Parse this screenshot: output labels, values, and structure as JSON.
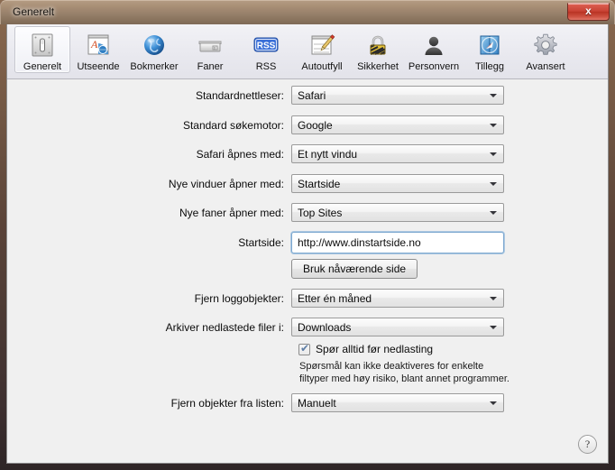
{
  "window": {
    "title": "Generelt",
    "close_label": "x",
    "frame_color": "#6e5442",
    "accent_close": "#c94335"
  },
  "toolbar": {
    "items": [
      {
        "label": "Generelt",
        "icon": "switch-icon",
        "selected": true
      },
      {
        "label": "Utseende",
        "icon": "appearance-icon",
        "selected": false
      },
      {
        "label": "Bokmerker",
        "icon": "globe-icon",
        "selected": false
      },
      {
        "label": "Faner",
        "icon": "tabs-icon",
        "selected": false
      },
      {
        "label": "RSS",
        "icon": "rss-icon",
        "selected": false
      },
      {
        "label": "Autoutfyll",
        "icon": "autofill-icon",
        "selected": false
      },
      {
        "label": "Sikkerhet",
        "icon": "lock-icon",
        "selected": false
      },
      {
        "label": "Personvern",
        "icon": "person-icon",
        "selected": false
      },
      {
        "label": "Tillegg",
        "icon": "extensions-icon",
        "selected": false
      },
      {
        "label": "Avansert",
        "icon": "gear-icon",
        "selected": false
      }
    ]
  },
  "preferences": {
    "rows": [
      {
        "label": "Standardnettleser:",
        "value": "Safari"
      },
      {
        "label": "Standard søkemotor:",
        "value": "Google"
      },
      {
        "label": "Safari åpnes med:",
        "value": "Et nytt vindu"
      },
      {
        "label": "Nye vinduer åpner med:",
        "value": "Startside"
      },
      {
        "label": "Nye faner åpner med:",
        "value": "Top Sites"
      }
    ],
    "homepage": {
      "label": "Startside:",
      "value": "http://www.dinstartside.no",
      "placeholder": "http://"
    },
    "use_current_page_button": "Bruk nåværende side",
    "history_row": {
      "label": "Fjern loggobjekter:",
      "value": "Etter én måned"
    },
    "downloads_row": {
      "label": "Arkiver nedlastede filer i:",
      "value": "Downloads"
    },
    "ask_before_download": {
      "label": "Spør alltid før nedlasting",
      "checked": true,
      "check_glyph": "✔"
    },
    "download_hint_line1": "Spørsmål kan ikke deaktiveres for enkelte",
    "download_hint_line2": "filtyper med høy risiko, blant annet programmer.",
    "remove_items_row": {
      "label": "Fjern objekter fra listen:",
      "value": "Manuelt"
    }
  },
  "help": {
    "glyph": "?",
    "name": "help-icon"
  }
}
